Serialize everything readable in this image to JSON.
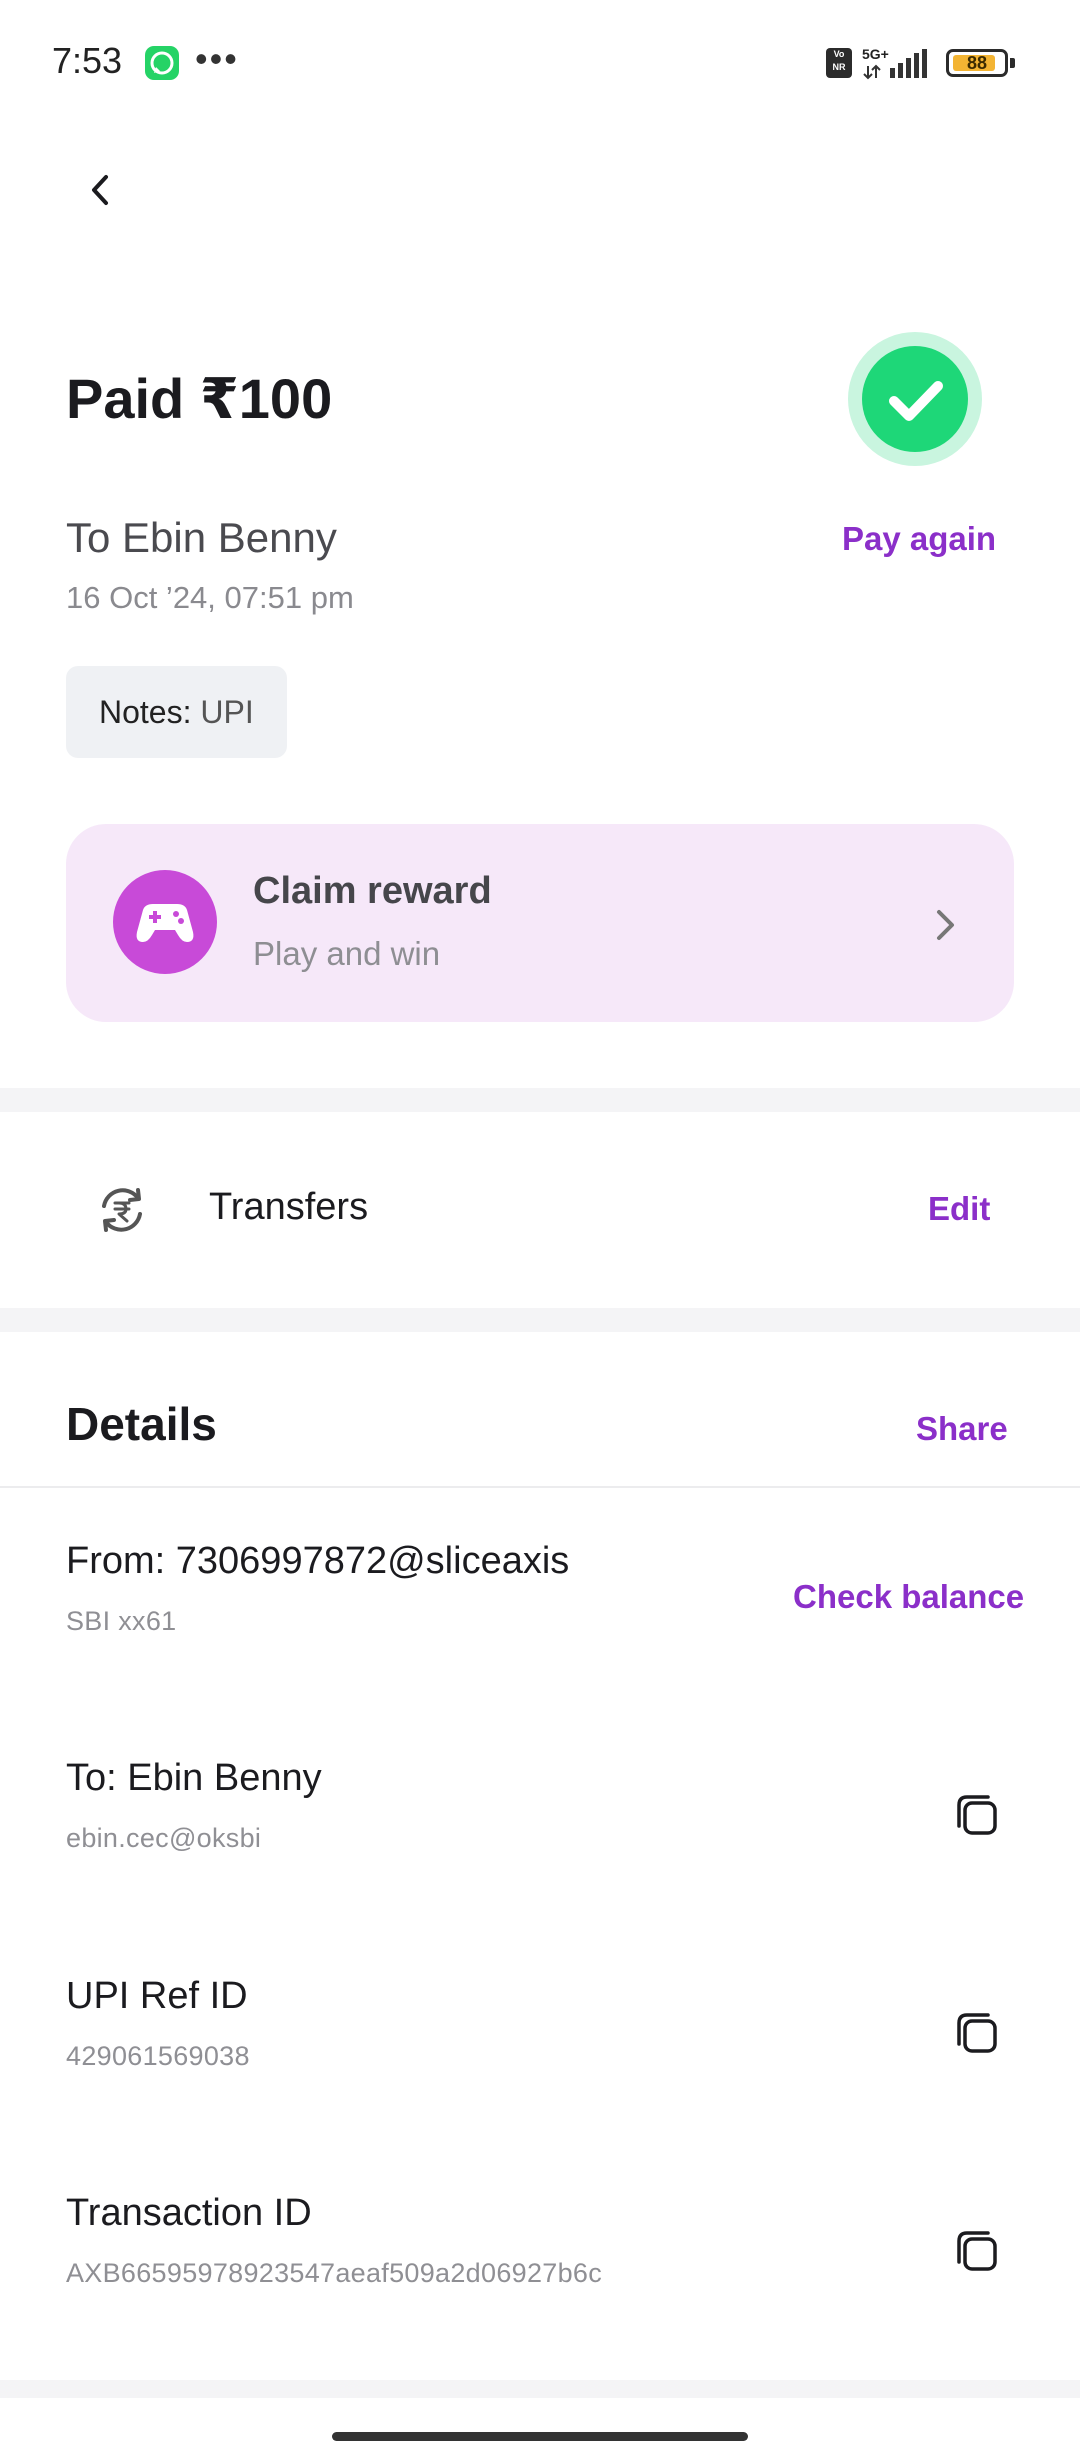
{
  "status_bar": {
    "time": "7:53",
    "more": "•••",
    "volte": "Vo NR",
    "network": "5G+",
    "battery": "88",
    "battery_level": 0.88
  },
  "header": {
    "back_icon": "chevron-left-icon"
  },
  "summary": {
    "title": "Paid ₹100",
    "status_icon": "check-circle-icon",
    "status_color": "#1ed778",
    "to": "To Ebin Benny",
    "datetime": "16 Oct ’24, 07:51 pm",
    "pay_again": "Pay again",
    "notes_label": "Notes:",
    "notes_value": "UPI"
  },
  "reward": {
    "title": "Claim reward",
    "subtitle": "Play and win",
    "icon": "gamepad-icon",
    "background": "#f6e8f9"
  },
  "transfers": {
    "icon": "rupee-exchange-icon",
    "label": "Transfers",
    "edit": "Edit"
  },
  "details": {
    "heading": "Details",
    "share": "Share",
    "from": {
      "title": "From: 7306997872@sliceaxis",
      "subtitle": "SBI xx61",
      "action": "Check balance"
    },
    "to": {
      "title": "To: Ebin Benny",
      "subtitle": "ebin.cec@oksbi"
    },
    "upi_ref": {
      "title": "UPI Ref ID",
      "subtitle": "429061569038"
    },
    "transaction": {
      "title": "Transaction ID",
      "subtitle": "AXB66595978923547aeaf509a2d06927b6c"
    }
  },
  "colors": {
    "accent": "#8b2fc9",
    "success": "#1ed778",
    "reward_icon": "#c84ad8"
  }
}
